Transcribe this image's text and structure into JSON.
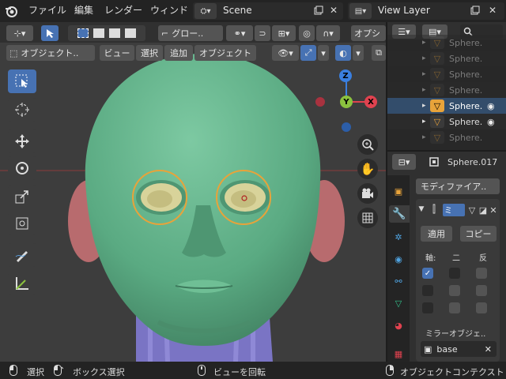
{
  "topbar": {
    "menus": [
      "ファイル",
      "編集",
      "レンダー",
      "ウィンド"
    ],
    "scene_name": "Scene",
    "view_layer": "View Layer"
  },
  "header": {
    "transform_orientation": "グロー..",
    "overlay_label": "オプシ",
    "mode_label": "オブジェクト..",
    "menus": [
      "ビュー",
      "選択",
      "追加",
      "オブジェクト"
    ]
  },
  "gizmo": {
    "z": "Z",
    "y": "Y",
    "x": "X"
  },
  "outliner": {
    "rows": [
      {
        "name": "Sphere.",
        "selected": false,
        "active": false,
        "dim": true
      },
      {
        "name": "Sphere.",
        "selected": false,
        "active": false,
        "dim": true
      },
      {
        "name": "Sphere.",
        "selected": false,
        "active": false,
        "dim": true
      },
      {
        "name": "Sphere.",
        "selected": false,
        "active": false,
        "dim": true
      },
      {
        "name": "Sphere.",
        "selected": true,
        "active": true,
        "dim": false
      },
      {
        "name": "Sphere.",
        "selected": false,
        "active": false,
        "dim": false
      },
      {
        "name": "Sphere.",
        "selected": false,
        "active": false,
        "dim": true
      }
    ]
  },
  "properties": {
    "object_name": "Sphere.017",
    "add_modifier": "モディファイア..",
    "modifier_name": "ミ",
    "apply": "適用",
    "copy": "コピー",
    "axis_label": "軸:",
    "bisect_label": "二",
    "flip_label": "反",
    "mirror_object_label": "ミラーオブジェ..",
    "mirror_object_value": "base"
  },
  "statusbar": {
    "select": "選択",
    "box_select": "ボックス選択",
    "rotate_view": "ビューを回転",
    "context": "オブジェクトコンテクスト"
  },
  "colors": {
    "accent": "#4772b3",
    "head": "#5fb088",
    "eye_ring": "#e8a33a",
    "x_axis": "#e0424f",
    "y_axis": "#8bc23f",
    "z_axis": "#3a7fe0"
  }
}
